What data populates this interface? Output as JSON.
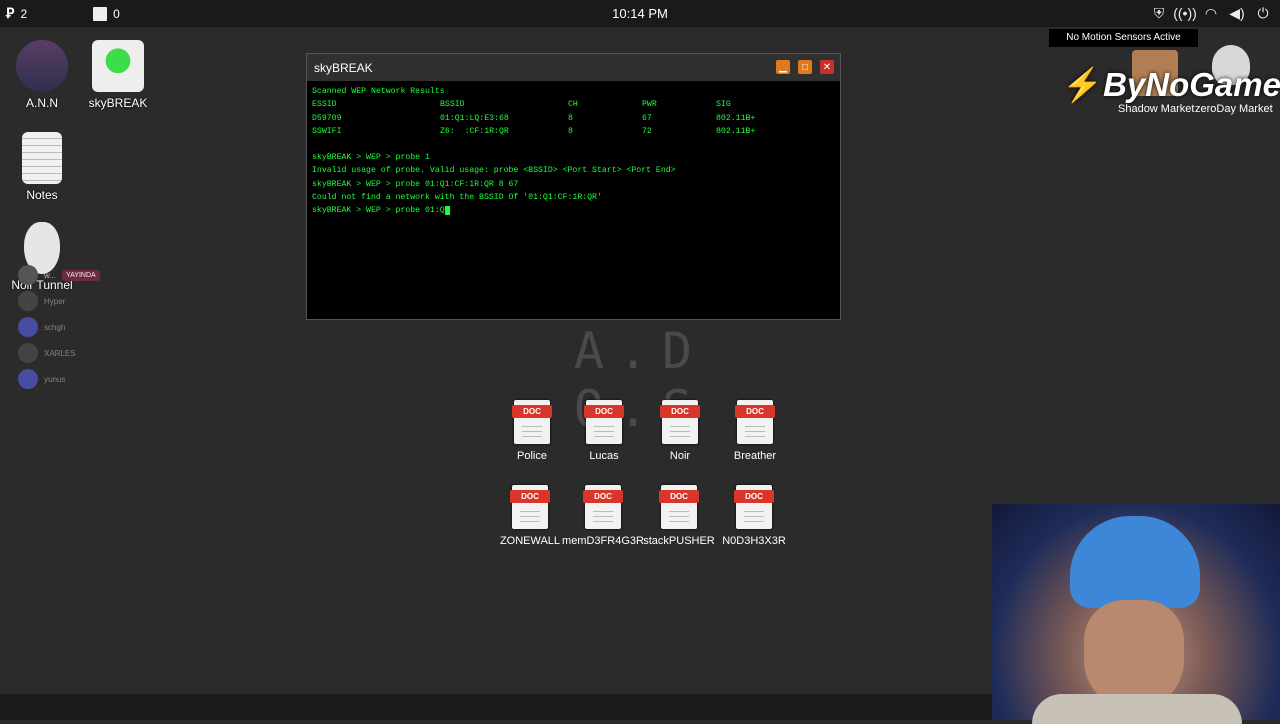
{
  "topbar": {
    "left": [
      {
        "icon": "app-logo-icon",
        "count": "2"
      },
      {
        "icon": "book-icon",
        "count": "0"
      }
    ],
    "clock": "10:14 PM",
    "right_icons": [
      "shield-icon",
      "broadcast-icon",
      "wifi-icon",
      "volume-icon",
      "power-icon"
    ]
  },
  "desktop": {
    "icons": [
      {
        "label": "A.N.N"
      },
      {
        "label": "skyBREAK"
      },
      {
        "label": "Notes"
      },
      {
        "label": "Noir Tunnel"
      }
    ]
  },
  "discord_overlay": {
    "badge": "YAYINDA",
    "users": [
      "w...",
      "Hyper",
      "schgh",
      "XARLES",
      "yunus"
    ]
  },
  "window": {
    "title": "skyBREAK",
    "terminal": {
      "header": "Scanned WEP Network Results",
      "columns": [
        "ESSID",
        "BSSID",
        "CH",
        "PWR",
        "SIG"
      ],
      "rows": [
        [
          "D59709",
          "01:Q1:LQ:E3:68",
          "8",
          "67",
          "802.11B+"
        ],
        [
          "SSWIFI",
          "Z6:  :CF:1R:QR",
          "8",
          "72",
          "802.11B+"
        ]
      ],
      "log": [
        "skyBREAK > WEP > probe 1",
        "Invalid usage of probe. Valid usage: probe <BSSID> <Port Start> <Port End>",
        "skyBREAK > WEP > probe 01:Q1:CF:1R:QR 8 67",
        "Could not find a network with the BSSID Of '01:Q1:CF:1R:QR'"
      ],
      "prompt": "skyBREAK > WEP > probe 01:Q"
    }
  },
  "ados_title": "A.D O.S",
  "docs": [
    {
      "label": "Police"
    },
    {
      "label": "Lucas"
    },
    {
      "label": "Noir"
    },
    {
      "label": "Breather"
    },
    {
      "label": "ZONEWALL"
    },
    {
      "label": "memD3FR4G3R"
    },
    {
      "label": "stackPUSHER"
    },
    {
      "label": "N0D3H3X3R"
    }
  ],
  "doc_tag": "DOC",
  "stream_overlay": {
    "notification": "No Motion Sensors Active",
    "brand": "ByNoGame",
    "shadow_market": "Shadow Market",
    "zeroday_market": "zeroDay Market"
  },
  "colors": {
    "terminal_text": "#1eff3c",
    "window_button": "#e07a1f",
    "close_button": "#c9302c",
    "doc_tag": "#d9362b"
  }
}
